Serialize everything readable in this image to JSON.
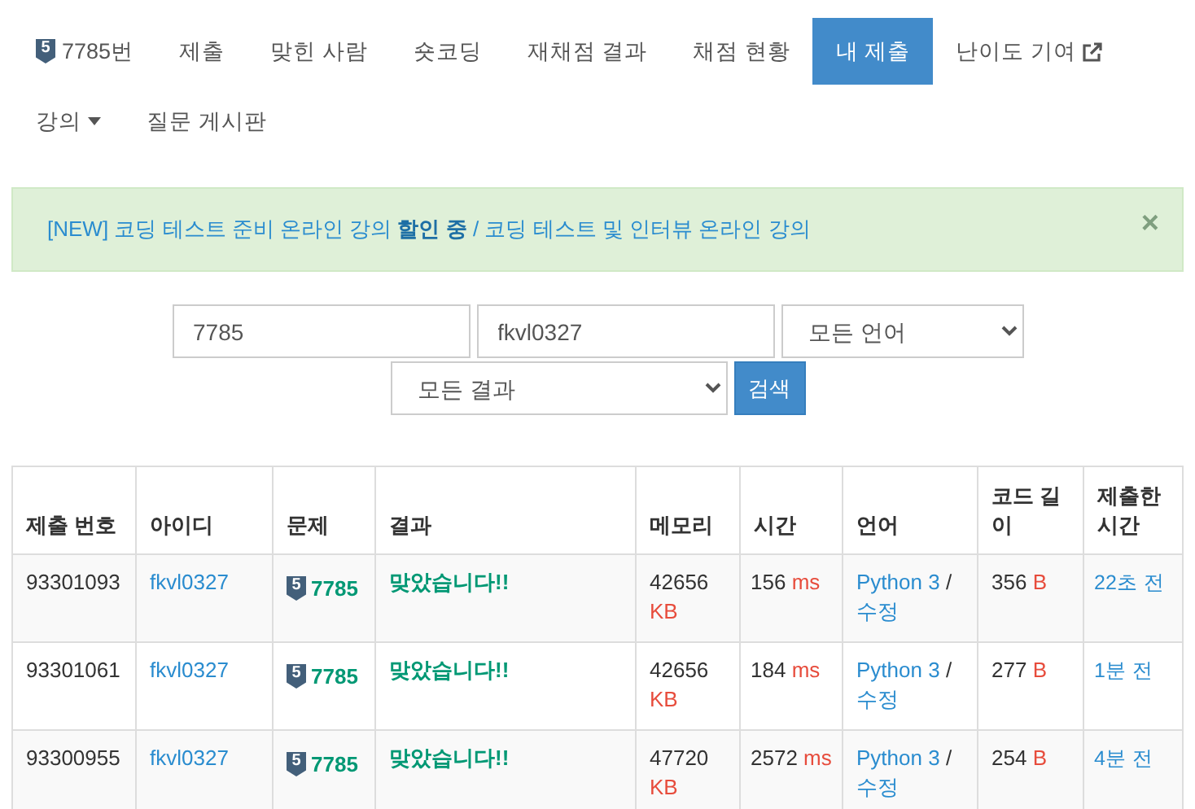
{
  "nav": {
    "tier": "5",
    "problem": "7785번",
    "items": [
      {
        "label": "제출",
        "selected": false,
        "kind": "link"
      },
      {
        "label": "맞힌 사람",
        "selected": false,
        "kind": "link"
      },
      {
        "label": "숏코딩",
        "selected": false,
        "kind": "link"
      },
      {
        "label": "재채점 결과",
        "selected": false,
        "kind": "link"
      },
      {
        "label": "채점 현황",
        "selected": false,
        "kind": "link"
      },
      {
        "label": "내 제출",
        "selected": true,
        "kind": "link"
      },
      {
        "label": "난이도 기여",
        "selected": false,
        "kind": "external"
      },
      {
        "label": "강의",
        "selected": false,
        "kind": "dropdown"
      },
      {
        "label": "질문 게시판",
        "selected": false,
        "kind": "link"
      }
    ]
  },
  "alert": {
    "text": "[NEW] 코딩 테스트 준비 온라인 강의 **할인 중** / 코딩 테스트 및 인터뷰 온라인 강의",
    "close": "×"
  },
  "search": {
    "problem_id": "7785",
    "user_id": "fkvl0327",
    "language": "모든 언어",
    "result": "모든 결과",
    "button": "검색"
  },
  "table": {
    "columns": [
      "제출 번호",
      "아이디",
      "문제",
      "결과",
      "메모리",
      "시간",
      "언어",
      "코드 길이",
      "제출한 시간"
    ],
    "rows": [
      {
        "id": "93301093",
        "user": "fkvl0327",
        "tier": "5",
        "problem": "7785",
        "result": "맞았습니다!!",
        "memory": "42656",
        "memory_unit": "KB",
        "time": "156",
        "time_unit": "ms",
        "language": "Python 3",
        "separator": "/",
        "edit": "수정",
        "length": "356",
        "length_unit": "B",
        "submitted": "22초 전"
      },
      {
        "id": "93301061",
        "user": "fkvl0327",
        "tier": "5",
        "problem": "7785",
        "result": "맞았습니다!!",
        "memory": "42656",
        "memory_unit": "KB",
        "time": "184",
        "time_unit": "ms",
        "language": "Python 3",
        "separator": "/",
        "edit": "수정",
        "length": "277",
        "length_unit": "B",
        "submitted": "1분 전"
      },
      {
        "id": "93300955",
        "user": "fkvl0327",
        "tier": "5",
        "problem": "7785",
        "result": "맞았습니다!!",
        "memory": "47720",
        "memory_unit": "KB",
        "time": "2572",
        "time_unit": "ms",
        "language": "Python 3",
        "separator": "/",
        "edit": "수정",
        "length": "254",
        "length_unit": "B",
        "submitted": "4분 전"
      }
    ]
  }
}
